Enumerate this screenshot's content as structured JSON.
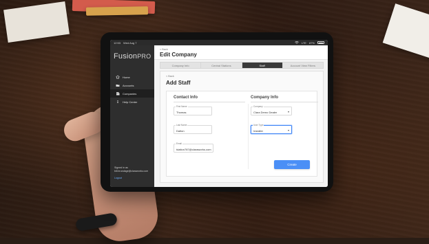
{
  "scene": {
    "title": "Tablet on wooden desk"
  },
  "status": {
    "left_time": "12:53",
    "left_date": "Wed Aug 7",
    "right_wifi": "LTE",
    "right_battery": "87%"
  },
  "app": {
    "brand_main": "Fusion",
    "brand_pro": "PRO"
  },
  "sidebar": {
    "items": [
      {
        "icon": "home-icon",
        "label": "Home",
        "active": false
      },
      {
        "icon": "folder-icon",
        "label": "Accounts",
        "active": false
      },
      {
        "icon": "building-icon",
        "label": "Companies",
        "active": true
      },
      {
        "icon": "info-icon",
        "label": "Help Center",
        "active": false
      }
    ],
    "footer": {
      "signed_in_as": "Signed in as",
      "email": "bill.brundage@claraworks.com",
      "logout": "Logout"
    }
  },
  "header": {
    "back_label": "< Back",
    "title": "Edit Company"
  },
  "tabs": [
    {
      "label": "Company Info",
      "active": false
    },
    {
      "label": "Central Stations",
      "active": false
    },
    {
      "label": "Staff",
      "active": true
    },
    {
      "label": "Account View Filters",
      "active": false
    }
  ],
  "content": {
    "back_label": "< Back",
    "section_title": "Add Staff",
    "contact_title": "Contact Info",
    "company_title": "Company Info",
    "fields": {
      "first_name_label": "First Name",
      "first_name_value": "Thomas",
      "last_name_label": "Last Name",
      "last_name_value": "Dalton",
      "email_label": "Email",
      "email_value": "tdalton787@claraworks.com",
      "company_label": "Company",
      "company_value": "Clara Demo Dealer",
      "user_type_label": "User Type",
      "user_type_value": "Installer"
    },
    "create_label": "Create"
  },
  "colors": {
    "accent": "#4b8ff6",
    "focus": "#3b82f6",
    "sidebar": "#2e2e2e",
    "tab_active": "#3a3a3a"
  }
}
